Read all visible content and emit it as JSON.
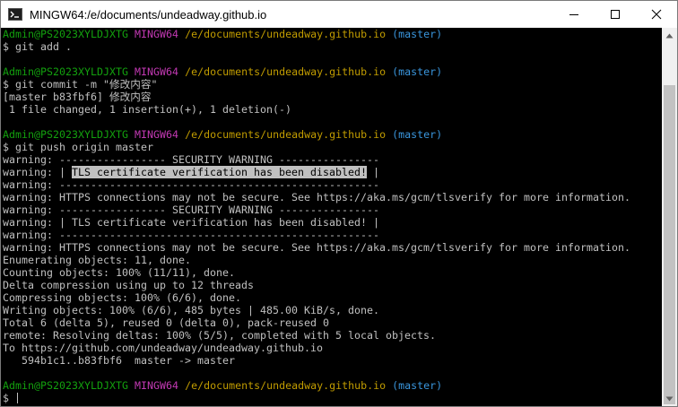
{
  "window": {
    "title": "MINGW64:/e/documents/undeadway.github.io",
    "icon": "mingw-terminal-icon",
    "controls": [
      "minimize-icon",
      "maximize-icon",
      "close-icon"
    ]
  },
  "prompt": {
    "user": "Admin@PS2023XYLDJXTG",
    "system": "MINGW64",
    "path": "/e/documents/undeadway.github.io",
    "branch": "(master)",
    "symbol": "$ "
  },
  "colors": {
    "user": "#13a10e",
    "system": "#c239b3",
    "path": "#c19c00",
    "branch": "#3a96dd",
    "text": "#c0c0c0",
    "background": "#000000"
  },
  "terminal": {
    "lines": [
      {
        "kind": "prompt"
      },
      {
        "kind": "cmd",
        "text": "$ git add ."
      },
      {
        "kind": "blank"
      },
      {
        "kind": "prompt"
      },
      {
        "kind": "cmd",
        "text": "$ git commit -m \"修改内容\""
      },
      {
        "kind": "text",
        "text": "[master b83fbf6] 修改内容"
      },
      {
        "kind": "text",
        "text": " 1 file changed, 1 insertion(+), 1 deletion(-)"
      },
      {
        "kind": "blank"
      },
      {
        "kind": "prompt"
      },
      {
        "kind": "cmd",
        "text": "$ git push origin master"
      },
      {
        "kind": "text",
        "text": "warning: ----------------- SECURITY WARNING ----------------"
      },
      {
        "kind": "hl",
        "pre": "warning: | ",
        "hl": "TLS certificate verification has been disabled!",
        "post": " |"
      },
      {
        "kind": "text",
        "text": "warning: ---------------------------------------------------"
      },
      {
        "kind": "text",
        "text": "warning: HTTPS connections may not be secure. See https://aka.ms/gcm/tlsverify for more information."
      },
      {
        "kind": "text",
        "text": "warning: ----------------- SECURITY WARNING ----------------"
      },
      {
        "kind": "text",
        "text": "warning: | TLS certificate verification has been disabled! |"
      },
      {
        "kind": "text",
        "text": "warning: ---------------------------------------------------"
      },
      {
        "kind": "text",
        "text": "warning: HTTPS connections may not be secure. See https://aka.ms/gcm/tlsverify for more information."
      },
      {
        "kind": "text",
        "text": "Enumerating objects: 11, done."
      },
      {
        "kind": "text",
        "text": "Counting objects: 100% (11/11), done."
      },
      {
        "kind": "text",
        "text": "Delta compression using up to 12 threads"
      },
      {
        "kind": "text",
        "text": "Compressing objects: 100% (6/6), done."
      },
      {
        "kind": "text",
        "text": "Writing objects: 100% (6/6), 485 bytes | 485.00 KiB/s, done."
      },
      {
        "kind": "text",
        "text": "Total 6 (delta 5), reused 0 (delta 0), pack-reused 0"
      },
      {
        "kind": "text",
        "text": "remote: Resolving deltas: 100% (5/5), completed with 5 local objects."
      },
      {
        "kind": "text",
        "text": "To https://github.com/undeadway/undeadway.github.io"
      },
      {
        "kind": "text",
        "text": "   594b1c1..b83fbf6  master -> master"
      },
      {
        "kind": "blank"
      },
      {
        "kind": "prompt"
      },
      {
        "kind": "input",
        "text": "$ "
      }
    ]
  }
}
